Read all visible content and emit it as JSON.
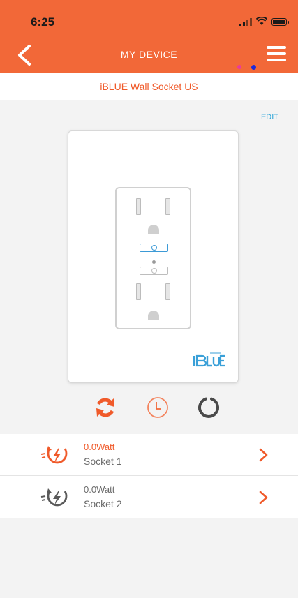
{
  "status_bar": {
    "time": "6:25"
  },
  "header": {
    "title": "MY DEVICE"
  },
  "device": {
    "name": "iBLUE Wall Socket US",
    "edit_label": "EDIT"
  },
  "sockets": [
    {
      "watt": "0.0Watt",
      "name": "Socket 1",
      "active": true
    },
    {
      "watt": "0.0Watt",
      "name": "Socket 2",
      "active": false
    }
  ],
  "colors": {
    "accent": "#f26838",
    "link": "#27a4d8",
    "inactive": "#6a6a6a"
  },
  "icons": {
    "back": "chevron-left-icon",
    "menu": "hamburger-menu-icon",
    "refresh": "refresh-icon",
    "timer": "clock-icon",
    "power": "power-ring-icon",
    "socket_power": "power-plug-icon",
    "row_arrow": "chevron-right-icon"
  }
}
